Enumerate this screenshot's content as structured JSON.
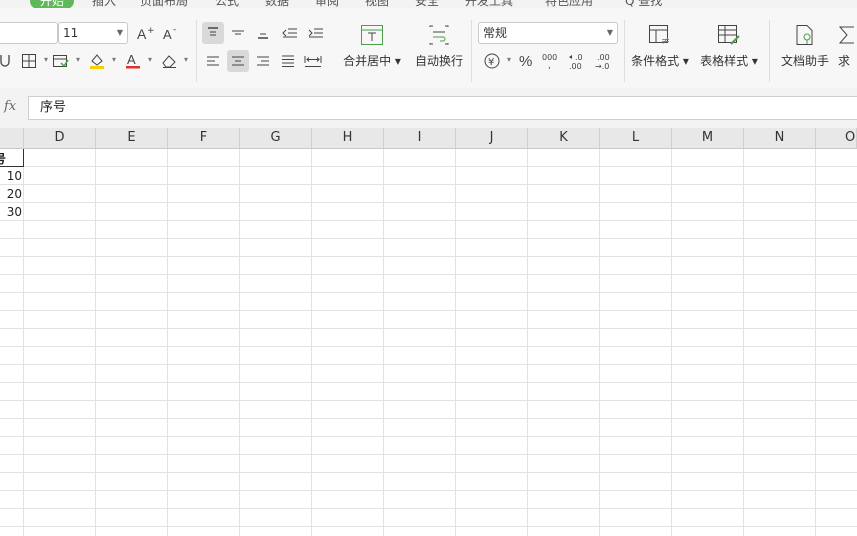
{
  "menu": {
    "tabs": [
      {
        "label": "开始",
        "active": true
      },
      {
        "label": "插入"
      },
      {
        "label": "页面布局"
      },
      {
        "label": "公式"
      },
      {
        "label": "数据"
      },
      {
        "label": "审阅"
      },
      {
        "label": "视图"
      },
      {
        "label": "安全"
      },
      {
        "label": "开发工具"
      },
      {
        "label": "特色应用"
      },
      {
        "label": "Q 查找"
      }
    ]
  },
  "ribbon": {
    "font_size": "11",
    "number_format": "常规",
    "merge_center": "合并居中",
    "wrap_text": "自动换行",
    "conditional_format": "条件格式",
    "table_style": "表格样式",
    "doc_assistant": "文档助手",
    "partial_label": "求"
  },
  "formula_bar": {
    "fx": "fx",
    "content": "序号"
  },
  "columns": [
    "D",
    "E",
    "F",
    "G",
    "H",
    "I",
    "J",
    "K",
    "L",
    "M",
    "N",
    "O"
  ],
  "cells": {
    "header_partial": "号",
    "row2": "10",
    "row3": "20",
    "row4": "30"
  },
  "colors": {
    "active_tab": "#5fb85a",
    "font_color_underline": "#e03030",
    "fill_color_underline": "#f5d100"
  }
}
